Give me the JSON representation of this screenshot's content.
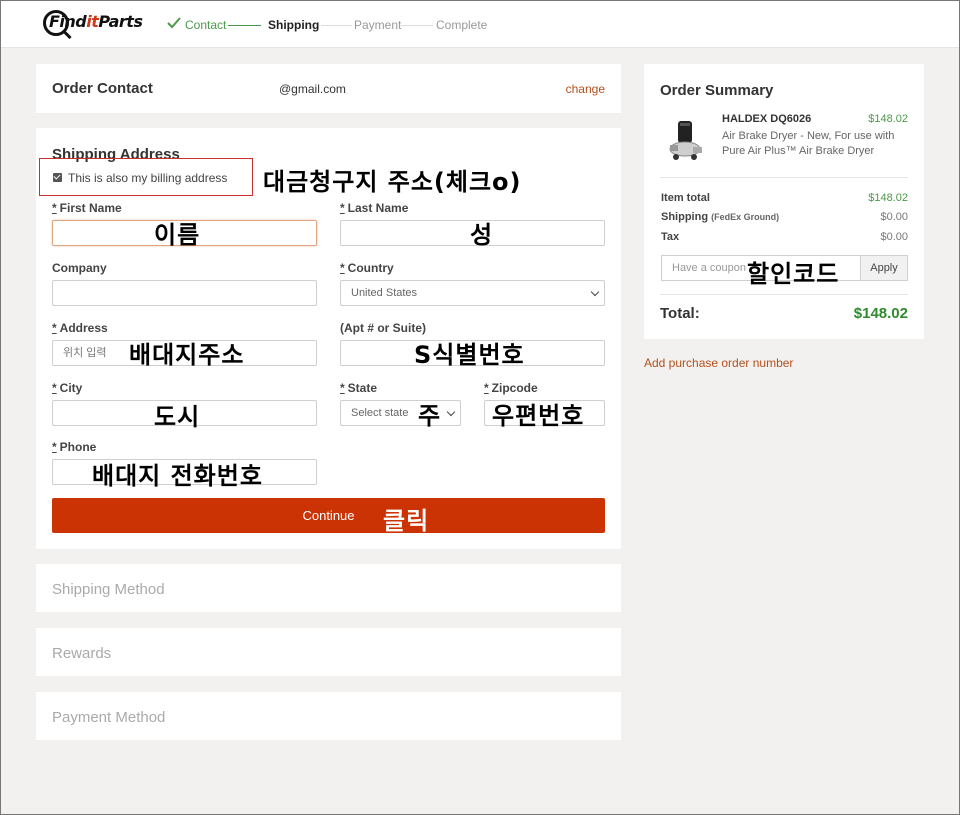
{
  "header": {
    "logo_text_a": "Find",
    "logo_text_b": "it",
    "logo_text_c": "Parts",
    "steps": [
      "Contact",
      "Shipping",
      "Payment",
      "Complete"
    ]
  },
  "contact": {
    "title": "Order Contact",
    "email": "@gmail.com",
    "change_label": "change"
  },
  "shipping": {
    "title": "Shipping Address",
    "billing_label": "This is also my billing address",
    "req_mark": "*",
    "first_name_label": "First Name",
    "last_name_label": "Last Name",
    "company_label": "Company",
    "country_label": "Country",
    "country_value": "United States",
    "address_label": "Address",
    "address_placeholder": "위치 입력",
    "apt_label": "(Apt # or Suite)",
    "city_label": "City",
    "state_label": "State",
    "state_placeholder": "Select state",
    "zip_label": "Zipcode",
    "phone_label": "Phone",
    "continue_label": "Continue"
  },
  "collapsed": {
    "shipping_method": "Shipping Method",
    "rewards": "Rewards",
    "payment_method": "Payment Method"
  },
  "summary": {
    "title": "Order Summary",
    "product_name": "HALDEX DQ6026",
    "product_price": "$148.02",
    "product_desc": "Air Brake Dryer - New, For use with Pure Air Plus™ Air Brake Dryer",
    "item_total_label": "Item total",
    "item_total_value": "$148.02",
    "shipping_label": "Shipping",
    "shipping_carrier": "(FedEx Ground)",
    "shipping_value": "$0.00",
    "tax_label": "Tax",
    "tax_value": "$0.00",
    "coupon_placeholder": "Have a coupon",
    "apply_label": "Apply",
    "total_label": "Total:",
    "total_value": "$148.02",
    "po_link": "Add purchase order number"
  },
  "annotations": {
    "billing": "대금청구지 주소(체크o)",
    "first_name": "이름",
    "last_name": "성",
    "address": "배대지주소",
    "apt": "S식별번호",
    "city": "도시",
    "state": "주",
    "zip": "우편번호",
    "phone": "배대지 전화번호",
    "continue": "클릭",
    "coupon": "할인코드"
  },
  "colors": {
    "accent": "#cc3304",
    "success": "#4b9a4b",
    "link": "#b3501d",
    "highlight_box": "#c9302c"
  }
}
